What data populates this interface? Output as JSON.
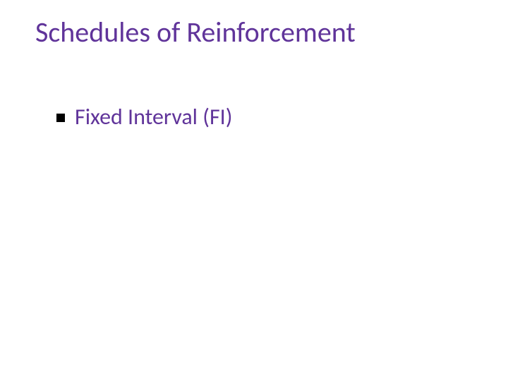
{
  "slide": {
    "title": "Schedules of Reinforcement",
    "bullets": [
      {
        "text": "Fixed Interval (FI)"
      }
    ]
  },
  "colors": {
    "accent": "#60349a",
    "bullet": "#000000"
  }
}
